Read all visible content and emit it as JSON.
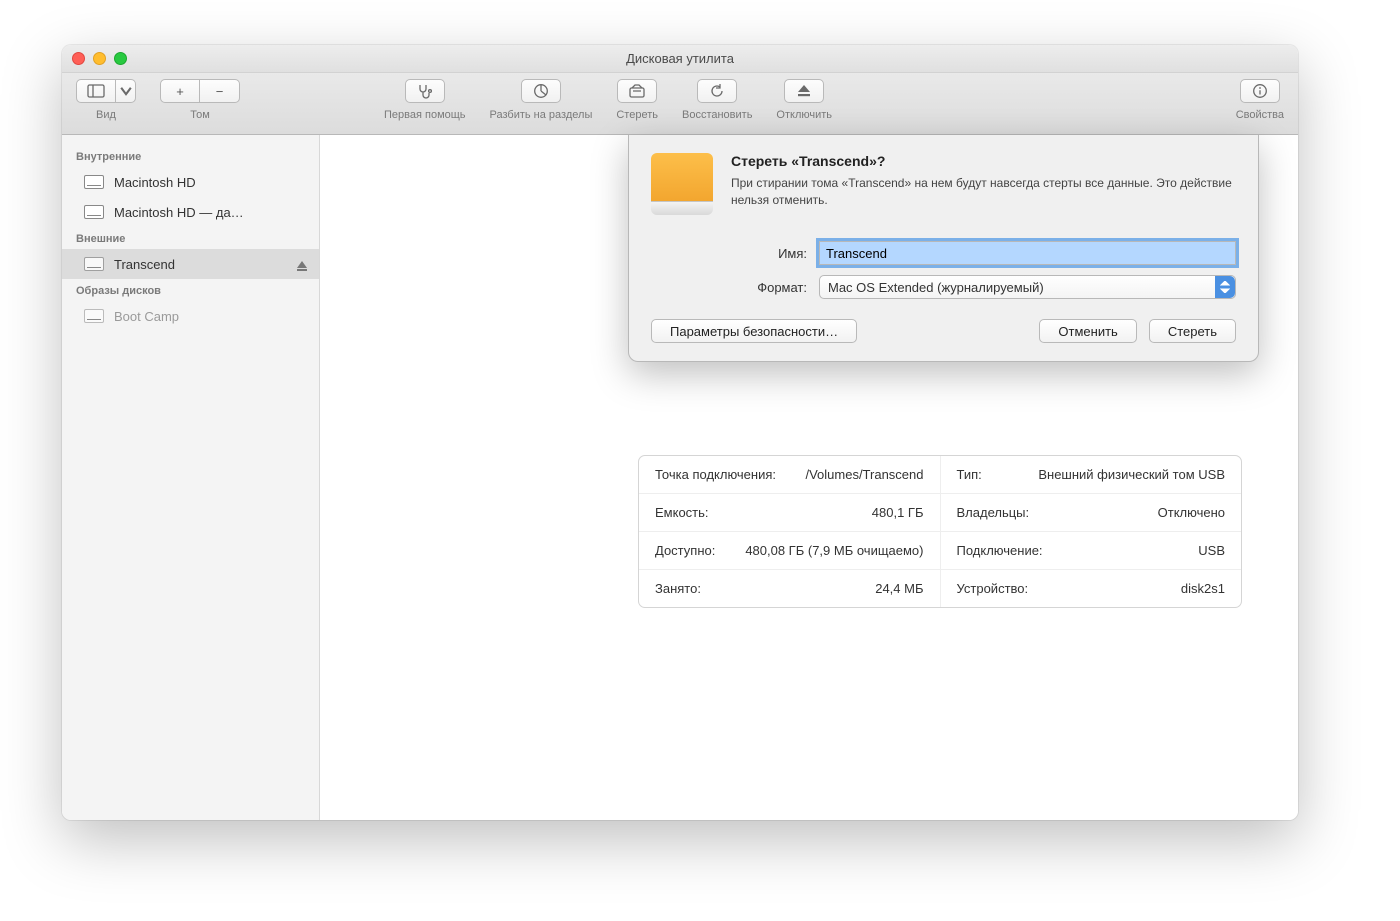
{
  "window": {
    "title": "Дисковая утилита"
  },
  "toolbar": {
    "view": {
      "label": "Вид"
    },
    "volume": {
      "label": "Том",
      "plus": "+",
      "minus": "−"
    },
    "first_aid": {
      "label": "Первая помощь"
    },
    "partition": {
      "label": "Разбить на разделы"
    },
    "erase": {
      "label": "Стереть"
    },
    "restore": {
      "label": "Восстановить"
    },
    "unmount": {
      "label": "Отключить"
    },
    "info": {
      "label": "Свойства"
    }
  },
  "sidebar": {
    "internal": {
      "header": "Внутренние",
      "items": [
        {
          "label": "Macintosh HD"
        },
        {
          "label": "Macintosh HD — да…"
        }
      ]
    },
    "external": {
      "header": "Внешние",
      "items": [
        {
          "label": "Transcend",
          "selected": true,
          "ejectable": true
        }
      ]
    },
    "images": {
      "header": "Образы дисков",
      "items": [
        {
          "label": "Boot Camp",
          "dim": true
        }
      ]
    }
  },
  "capacity_box": {
    "value": "480,1 ГБ"
  },
  "info_left": [
    {
      "k": "Точка подключения:",
      "v": "/Volumes/Transcend"
    },
    {
      "k": "Емкость:",
      "v": "480,1 ГБ"
    },
    {
      "k": "Доступно:",
      "v": "480,08 ГБ (7,9 МБ очищаемо)"
    },
    {
      "k": "Занято:",
      "v": "24,4 МБ"
    }
  ],
  "info_right": [
    {
      "k": "Тип:",
      "v": "Внешний физический том USB"
    },
    {
      "k": "Владельцы:",
      "v": "Отключено"
    },
    {
      "k": "Подключение:",
      "v": "USB"
    },
    {
      "k": "Устройство:",
      "v": "disk2s1"
    }
  ],
  "dialog": {
    "title": "Стереть «Transcend»?",
    "message": "При стирании тома «Transcend» на нем будут навсегда стерты все данные. Это действие нельзя отменить.",
    "name_label": "Имя:",
    "name_value": "Transcend",
    "format_label": "Формат:",
    "format_value": "Mac OS Extended (журналируемый)",
    "security_button": "Параметры безопасности…",
    "cancel_button": "Отменить",
    "erase_button": "Стереть"
  }
}
